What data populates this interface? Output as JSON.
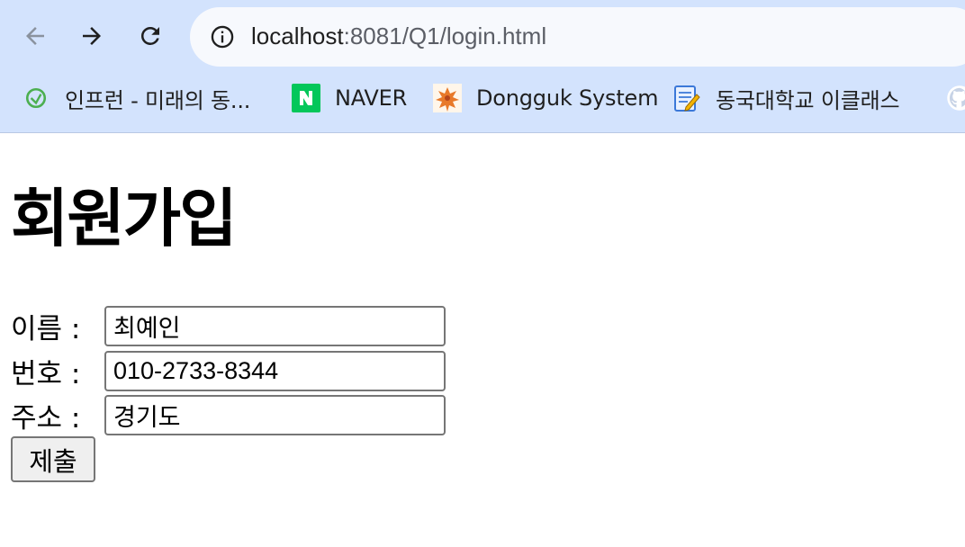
{
  "browser": {
    "url_host": "localhost",
    "url_rest": ":8081/Q1/login.html",
    "bookmarks": [
      {
        "label": "인프런 - 미래의 동...",
        "icon": "inflearn-icon",
        "color": "#4caf50"
      },
      {
        "label": "NAVER",
        "icon": "naver-icon",
        "color": "#03c75a"
      },
      {
        "label": "Dongguk System",
        "icon": "dongguk-leaf-icon",
        "color": "#e8792a"
      },
      {
        "label": "동국대학교 이클래스",
        "icon": "notepad-icon",
        "color": "#3b78d8"
      }
    ]
  },
  "page": {
    "title": "회원가입",
    "fields": [
      {
        "label": "이름 :",
        "value": "최예인"
      },
      {
        "label": "번호 :",
        "value": "010-2733-8344"
      },
      {
        "label": "주소 :",
        "value": "경기도"
      }
    ],
    "submit_label": "제출"
  }
}
